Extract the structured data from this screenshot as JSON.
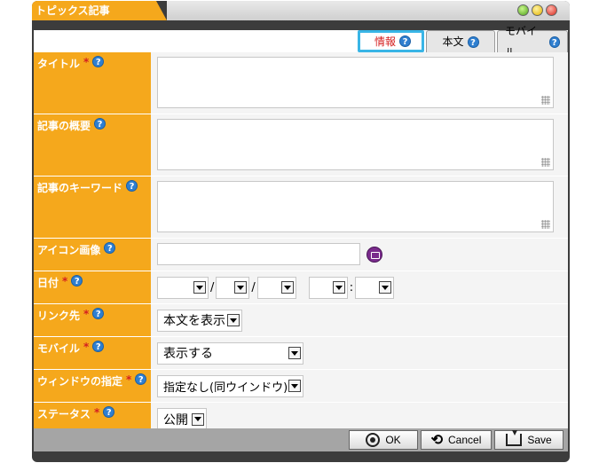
{
  "window": {
    "title": "トピックス記事"
  },
  "tabs": [
    {
      "label": "情報"
    },
    {
      "label": "本文"
    },
    {
      "label": "モバイル"
    }
  ],
  "fields": {
    "title": {
      "label": "タイトル",
      "required": "*"
    },
    "summary": {
      "label": "記事の概要"
    },
    "keywords": {
      "label": "記事のキーワード"
    },
    "icon_image": {
      "label": "アイコン画像"
    },
    "date": {
      "label": "日付",
      "required": "*",
      "sep1": "/",
      "sep2": "/",
      "sep3": ":"
    },
    "link_target": {
      "label": "リンク先",
      "required": "*",
      "value": "本文を表示"
    },
    "mobile": {
      "label": "モバイル",
      "required": "*",
      "value": "表示する"
    },
    "window_target": {
      "label": "ウィンドウの指定",
      "required": "*",
      "value": "指定なし(同ウインドウ)"
    },
    "status": {
      "label": "ステータス",
      "required": "*",
      "value": "公開"
    }
  },
  "buttons": {
    "ok": "OK",
    "cancel": "Cancel",
    "save": "Save"
  },
  "icons": {
    "help": "?",
    "cancel": "⟲"
  }
}
